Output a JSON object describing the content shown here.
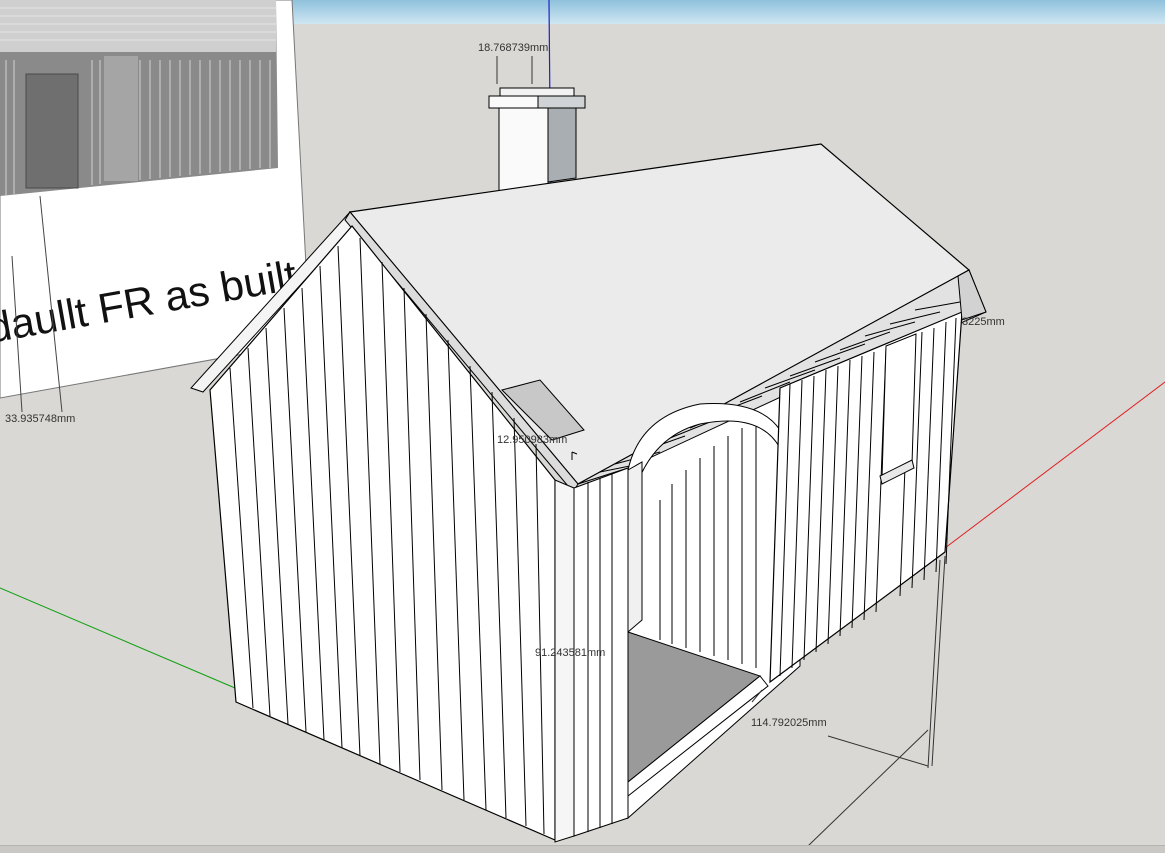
{
  "app": {
    "name": "SketchUp 3D model viewport"
  },
  "reference_image": {
    "caption": "daullt FR as built"
  },
  "dimensions": {
    "chimney_width": "18.768739mm",
    "left_height": "33.935748mm",
    "eave_offset": "12.950983mm",
    "wall_height": "91.243581mm",
    "depth": "114.792025mm",
    "right_partial": "3225mm"
  },
  "axes": {
    "blue": "#2020c8",
    "red": "#e02020",
    "green": "#10a010"
  },
  "colors": {
    "sky": "#a9cfe4",
    "ground": "#d9d8d4",
    "wall_shade": "#8f8f8f"
  }
}
